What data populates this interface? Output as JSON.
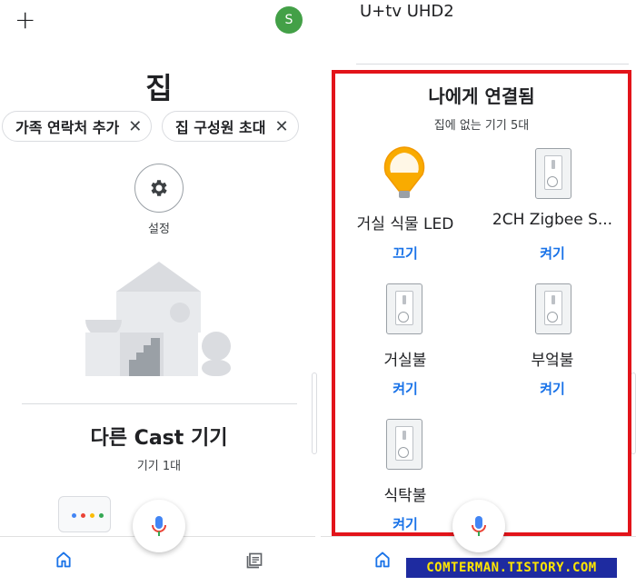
{
  "left": {
    "add_icon": "plus-icon",
    "avatar_letter": "S",
    "avatar_color": "#43a047",
    "home_title": "집",
    "chips": [
      {
        "label": "가족 연락처 추가",
        "close": "✕"
      },
      {
        "label": "집 구성원 초대",
        "close": "✕"
      }
    ],
    "settings_label": "설정",
    "cast_title": "다른 Cast 기기",
    "cast_sub": "기기 1대"
  },
  "right": {
    "tv_title": "U+tv UHD2",
    "linked_title": "나에게 연결됨",
    "linked_sub": "집에 없는 기기 5대",
    "devices": [
      {
        "name": "거실 식물 LED",
        "action": "끄기",
        "icon": "bulb-icon"
      },
      {
        "name": "2CH Zigbee S...",
        "action": "켜기",
        "icon": "switch-icon"
      },
      {
        "name": "거실불",
        "action": "켜기",
        "icon": "switch-icon"
      },
      {
        "name": "부엌불",
        "action": "켜기",
        "icon": "switch-icon"
      },
      {
        "name": "식탁불",
        "action": "켜기",
        "icon": "switch-icon"
      }
    ],
    "highlight_color": "#e2141a"
  },
  "nav": {
    "home_icon": "home-icon",
    "feed_icon": "feed-icon",
    "mic_icon": "mic-icon"
  },
  "watermark": "COMTERMAN.TISTORY.COM",
  "accent": "#1a73e8"
}
